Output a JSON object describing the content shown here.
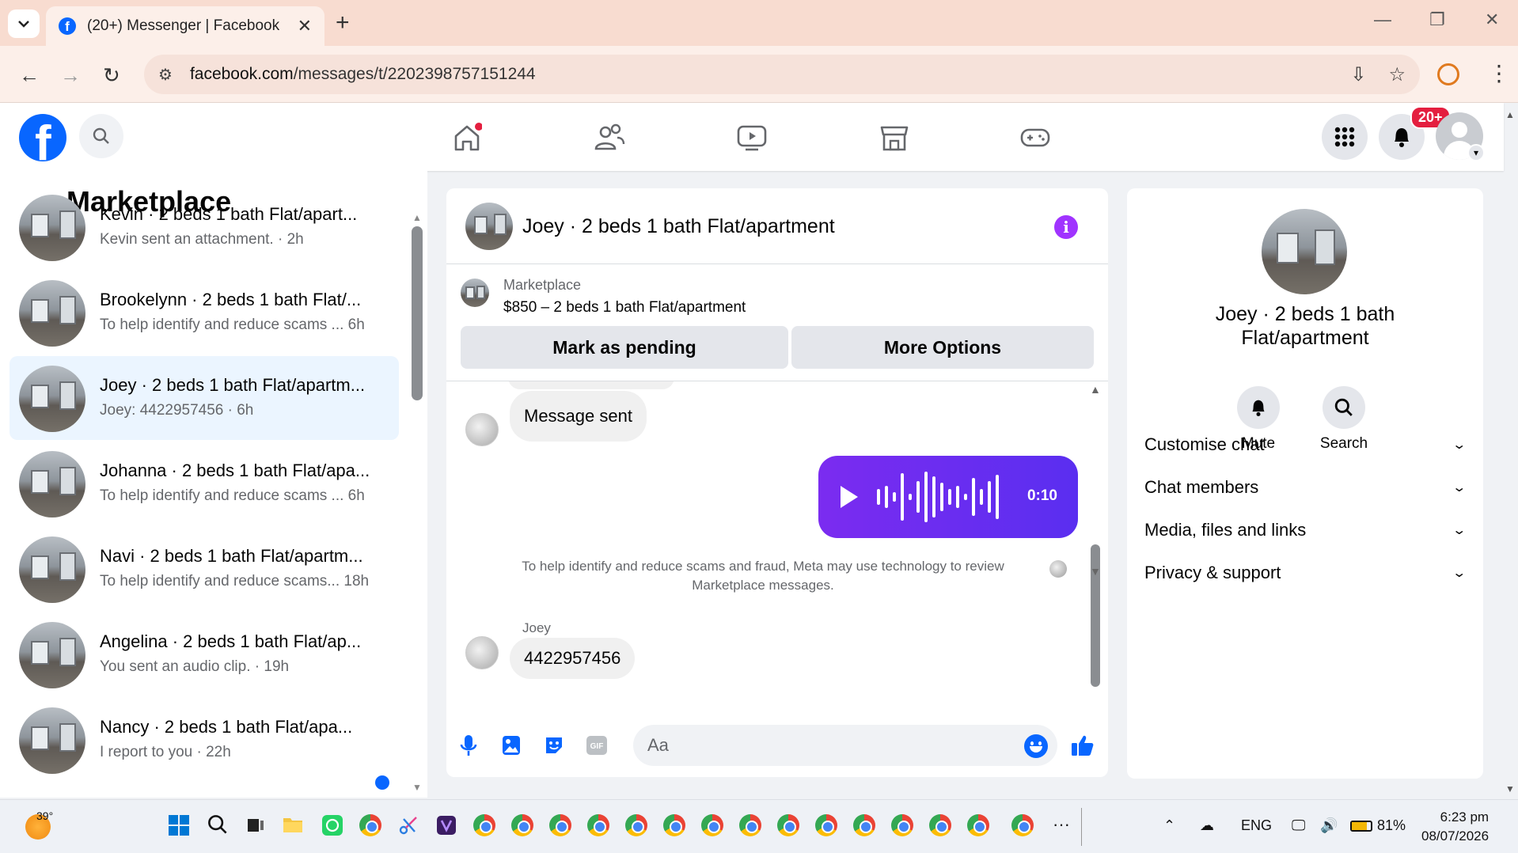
{
  "browser": {
    "tab_title": "(20+) Messenger | Facebook",
    "url_host": "facebook.com",
    "url_path": "/messages/t/2202398757151244",
    "new_tab_label": "+",
    "tab_close": "✕"
  },
  "fb": {
    "notification_badge": "20+",
    "accent_color": "#0866ff"
  },
  "sidebar": {
    "title": "Marketplace",
    "conversations": [
      {
        "name": "Kevin · 2 beds 1 bath Flat/apart...",
        "snippet": "Kevin sent an attachment. · 2h"
      },
      {
        "name": "Brookelynn · 2 beds 1 bath Flat/...",
        "snippet": "To help identify and reduce scams ...  6h"
      },
      {
        "name": "Joey · 2 beds 1 bath Flat/apartm...",
        "snippet": "Joey: 4422957456 · 6h"
      },
      {
        "name": "Johanna · 2 beds 1 bath Flat/apa...",
        "snippet": "To help identify and reduce scams ...  6h"
      },
      {
        "name": "Navi · 2 beds 1 bath Flat/apartm...",
        "snippet": "To help identify and reduce scams...  18h"
      },
      {
        "name": "Angelina · 2 beds 1 bath Flat/ap...",
        "snippet": "You sent an audio clip. · 19h"
      },
      {
        "name": "Nancy · 2 beds 1 bath Flat/apa...",
        "snippet": "I report to you · 22h"
      }
    ]
  },
  "chat": {
    "title": "Joey · 2 beds 1 bath Flat/apartment",
    "marketplace_label": "Marketplace",
    "listing": "$850 – 2 beds 1 bath Flat/apartment",
    "mark_pending": "Mark as pending",
    "more_options": "More Options",
    "msg_sent": "Message sent",
    "audio_duration": "0:10",
    "notice": "To help identify and reduce scams and fraud, Meta may use technology to review Marketplace messages.",
    "sender": "Joey",
    "last_message": "4422957456",
    "input_placeholder": "Aa"
  },
  "info": {
    "name": "Joey · 2 beds 1 bath Flat/apartment",
    "mute": "Mute",
    "search": "Search",
    "sections": [
      "Customise chat",
      "Chat members",
      "Media, files and links",
      "Privacy & support"
    ]
  },
  "taskbar": {
    "temperature": "39°",
    "language": "ENG",
    "battery": "81%",
    "time": "6:23 pm",
    "date": "08/07/2026"
  }
}
